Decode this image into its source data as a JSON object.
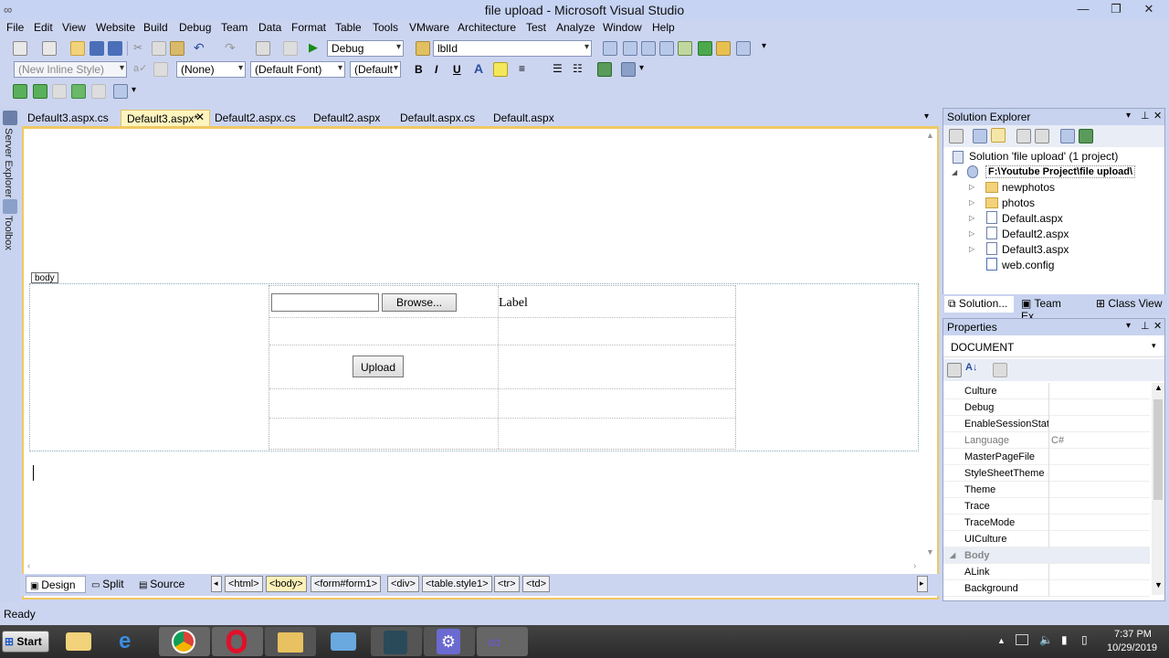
{
  "window": {
    "title": "file upload - Microsoft Visual Studio"
  },
  "menu": [
    "File",
    "Edit",
    "View",
    "Website",
    "Build",
    "Debug",
    "Team",
    "Data",
    "Format",
    "Table",
    "Tools",
    "VMware",
    "Architecture",
    "Test",
    "Analyze",
    "Window",
    "Help"
  ],
  "toolbar": {
    "config_value": "Debug",
    "find_value": "lblId",
    "style_value": "(New Inline Style)",
    "block_value": "(None)",
    "font_value": "(Default Font)",
    "size_value": "(Default",
    "bold_label": "B",
    "italic_label": "I",
    "underline_label": "U"
  },
  "side_tabs": {
    "server_explorer": "Server Explorer",
    "toolbox": "Toolbox"
  },
  "tabs": [
    {
      "label": "Default3.aspx.cs"
    },
    {
      "label": "Default3.aspx*",
      "active": true
    },
    {
      "label": "Default2.aspx.cs"
    },
    {
      "label": "Default2.aspx"
    },
    {
      "label": "Default.aspx.cs"
    },
    {
      "label": "Default.aspx"
    }
  ],
  "designer": {
    "body_tag": "body",
    "browse_label": "Browse...",
    "label_text": "Label",
    "upload_label": "Upload"
  },
  "view_buttons": {
    "design": "Design",
    "split": "Split",
    "source": "Source"
  },
  "breadcrumbs": [
    "<html>",
    "<body>",
    "<form#form1>",
    "<div>",
    "<table.style1>",
    "<tr>",
    "<td>"
  ],
  "solution_explorer": {
    "title": "Solution Explorer",
    "solution": "Solution 'file upload' (1 project)",
    "project": "F:\\Youtube Project\\file upload\\",
    "items": [
      "newphotos",
      "photos",
      "Default.aspx",
      "Default2.aspx",
      "Default3.aspx",
      "web.config"
    ]
  },
  "bottom_tabs": [
    "Solution...",
    "Team Ex...",
    "Class View"
  ],
  "properties": {
    "title": "Properties",
    "object": "DOCUMENT",
    "rows": [
      {
        "name": "Culture",
        "value": ""
      },
      {
        "name": "Debug",
        "value": ""
      },
      {
        "name": "EnableSessionState",
        "value": ""
      },
      {
        "name": "Language",
        "value": "C#"
      },
      {
        "name": "MasterPageFile",
        "value": ""
      },
      {
        "name": "StyleSheetTheme",
        "value": ""
      },
      {
        "name": "Theme",
        "value": ""
      },
      {
        "name": "Trace",
        "value": ""
      },
      {
        "name": "TraceMode",
        "value": ""
      },
      {
        "name": "UICulture",
        "value": ""
      },
      {
        "name": "Body",
        "value": ""
      },
      {
        "name": "ALink",
        "value": ""
      },
      {
        "name": "Background",
        "value": ""
      }
    ]
  },
  "status": {
    "text": "Ready"
  },
  "taskbar": {
    "start_label": "Start",
    "time": "7:37 PM",
    "date": "10/29/2019"
  }
}
